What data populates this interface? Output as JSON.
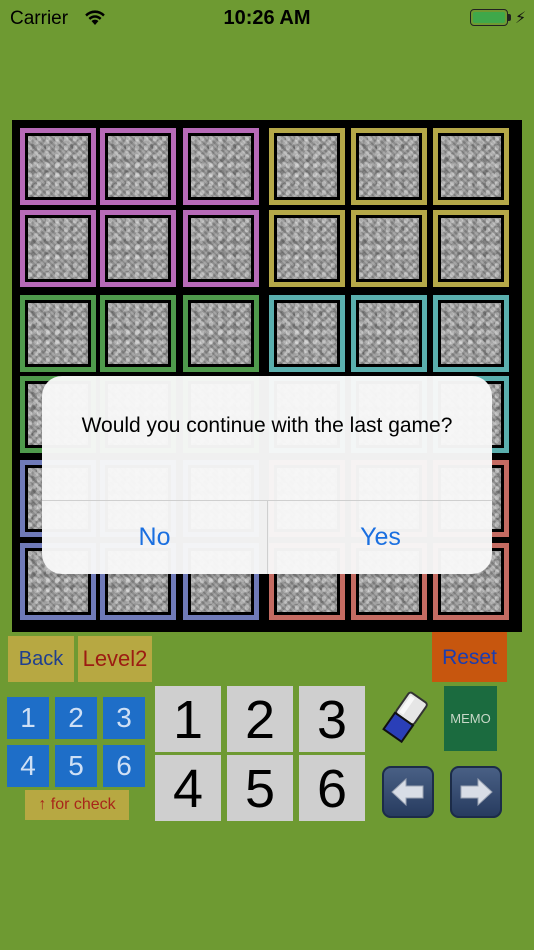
{
  "status_bar": {
    "carrier": "Carrier",
    "time": "10:26 AM",
    "battery_level": 1.0
  },
  "board": {
    "cells": "all-hidden",
    "region_colors": {
      "purple": "#b76ab8",
      "yellow": "#b5a848",
      "green": "#4f9a4c",
      "teal": "#5aafae",
      "blue": "#6f7ab8",
      "red": "#c46b62"
    },
    "cell_texture": "gray-stone"
  },
  "dialog": {
    "message": "Would you continue with the last game?",
    "no_label": "No",
    "yes_label": "Yes",
    "button_color": "#1a6fe0"
  },
  "controls": {
    "back_label": "Back",
    "level_label": "Level2",
    "reset_label": "Reset",
    "check_numbers": [
      "1",
      "2",
      "3",
      "4",
      "5",
      "6"
    ],
    "check_hint": "↑ for check",
    "input_numbers": [
      "1",
      "2",
      "3",
      "4",
      "5",
      "6"
    ],
    "memo_label": "MEMO",
    "icons": {
      "eraser": "eraser-icon",
      "left": "arrow-left-icon",
      "right": "arrow-right-icon"
    }
  }
}
